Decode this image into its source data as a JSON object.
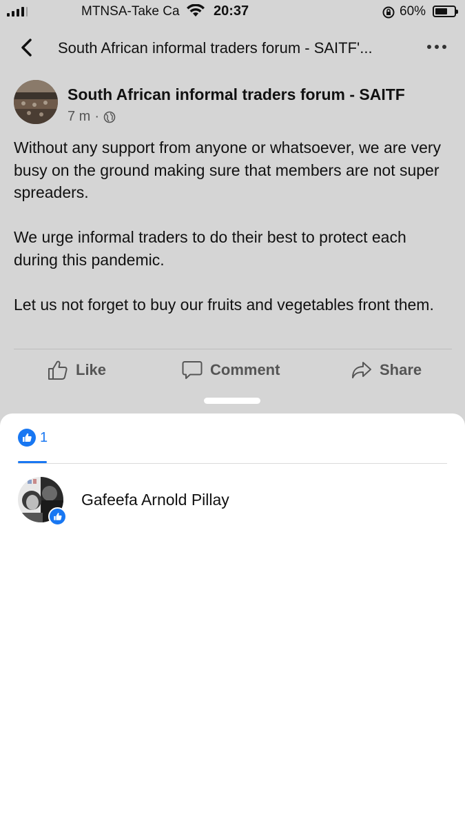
{
  "status_bar": {
    "carrier": "MTNSA-Take Ca",
    "time": "20:37",
    "battery": "60%",
    "battery_level": 0.6
  },
  "nav": {
    "title": "South African informal traders forum - SAITF'..."
  },
  "post": {
    "author": "South African informal traders forum - SAITF",
    "time_ago": "7 m",
    "separator": "·",
    "paragraphs": [
      "Without any support from anyone or whatsoever, we are very busy on the ground making sure that members are not super spreaders.",
      "We urge informal traders to do their best to protect each during this pandemic.",
      "Let us not forget to buy our fruits and vegetables front them."
    ],
    "actions": {
      "like": "Like",
      "comment": "Comment",
      "share": "Share"
    }
  },
  "reactions_sheet": {
    "tab_count": "1",
    "reactors": [
      {
        "name": "Gafeefa Arnold Pillay"
      }
    ]
  },
  "colors": {
    "brand_blue": "#1877f2",
    "overlay_gray": "#d5d5d5"
  }
}
